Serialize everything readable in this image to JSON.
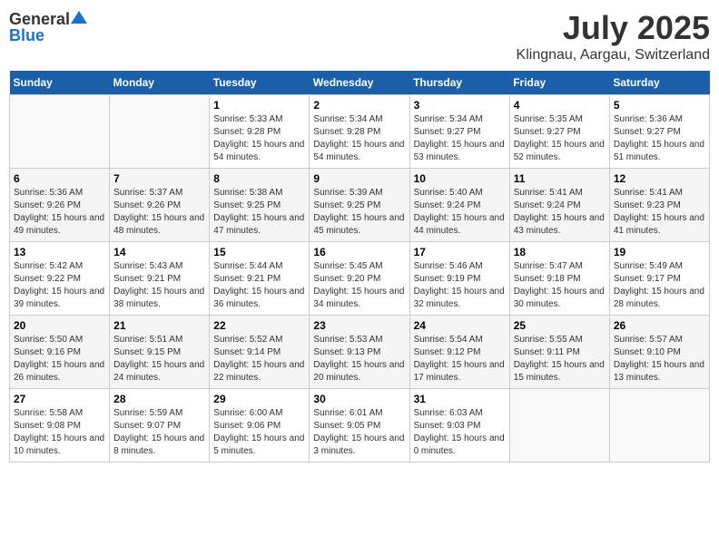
{
  "logo": {
    "general": "General",
    "blue": "Blue"
  },
  "title": "July 2025",
  "subtitle": "Klingnau, Aargau, Switzerland",
  "days_header": [
    "Sunday",
    "Monday",
    "Tuesday",
    "Wednesday",
    "Thursday",
    "Friday",
    "Saturday"
  ],
  "weeks": [
    [
      {
        "num": "",
        "sunrise": "",
        "sunset": "",
        "daylight": ""
      },
      {
        "num": "",
        "sunrise": "",
        "sunset": "",
        "daylight": ""
      },
      {
        "num": "1",
        "sunrise": "Sunrise: 5:33 AM",
        "sunset": "Sunset: 9:28 PM",
        "daylight": "Daylight: 15 hours and 54 minutes."
      },
      {
        "num": "2",
        "sunrise": "Sunrise: 5:34 AM",
        "sunset": "Sunset: 9:28 PM",
        "daylight": "Daylight: 15 hours and 54 minutes."
      },
      {
        "num": "3",
        "sunrise": "Sunrise: 5:34 AM",
        "sunset": "Sunset: 9:27 PM",
        "daylight": "Daylight: 15 hours and 53 minutes."
      },
      {
        "num": "4",
        "sunrise": "Sunrise: 5:35 AM",
        "sunset": "Sunset: 9:27 PM",
        "daylight": "Daylight: 15 hours and 52 minutes."
      },
      {
        "num": "5",
        "sunrise": "Sunrise: 5:36 AM",
        "sunset": "Sunset: 9:27 PM",
        "daylight": "Daylight: 15 hours and 51 minutes."
      }
    ],
    [
      {
        "num": "6",
        "sunrise": "Sunrise: 5:36 AM",
        "sunset": "Sunset: 9:26 PM",
        "daylight": "Daylight: 15 hours and 49 minutes."
      },
      {
        "num": "7",
        "sunrise": "Sunrise: 5:37 AM",
        "sunset": "Sunset: 9:26 PM",
        "daylight": "Daylight: 15 hours and 48 minutes."
      },
      {
        "num": "8",
        "sunrise": "Sunrise: 5:38 AM",
        "sunset": "Sunset: 9:25 PM",
        "daylight": "Daylight: 15 hours and 47 minutes."
      },
      {
        "num": "9",
        "sunrise": "Sunrise: 5:39 AM",
        "sunset": "Sunset: 9:25 PM",
        "daylight": "Daylight: 15 hours and 45 minutes."
      },
      {
        "num": "10",
        "sunrise": "Sunrise: 5:40 AM",
        "sunset": "Sunset: 9:24 PM",
        "daylight": "Daylight: 15 hours and 44 minutes."
      },
      {
        "num": "11",
        "sunrise": "Sunrise: 5:41 AM",
        "sunset": "Sunset: 9:24 PM",
        "daylight": "Daylight: 15 hours and 43 minutes."
      },
      {
        "num": "12",
        "sunrise": "Sunrise: 5:41 AM",
        "sunset": "Sunset: 9:23 PM",
        "daylight": "Daylight: 15 hours and 41 minutes."
      }
    ],
    [
      {
        "num": "13",
        "sunrise": "Sunrise: 5:42 AM",
        "sunset": "Sunset: 9:22 PM",
        "daylight": "Daylight: 15 hours and 39 minutes."
      },
      {
        "num": "14",
        "sunrise": "Sunrise: 5:43 AM",
        "sunset": "Sunset: 9:21 PM",
        "daylight": "Daylight: 15 hours and 38 minutes."
      },
      {
        "num": "15",
        "sunrise": "Sunrise: 5:44 AM",
        "sunset": "Sunset: 9:21 PM",
        "daylight": "Daylight: 15 hours and 36 minutes."
      },
      {
        "num": "16",
        "sunrise": "Sunrise: 5:45 AM",
        "sunset": "Sunset: 9:20 PM",
        "daylight": "Daylight: 15 hours and 34 minutes."
      },
      {
        "num": "17",
        "sunrise": "Sunrise: 5:46 AM",
        "sunset": "Sunset: 9:19 PM",
        "daylight": "Daylight: 15 hours and 32 minutes."
      },
      {
        "num": "18",
        "sunrise": "Sunrise: 5:47 AM",
        "sunset": "Sunset: 9:18 PM",
        "daylight": "Daylight: 15 hours and 30 minutes."
      },
      {
        "num": "19",
        "sunrise": "Sunrise: 5:49 AM",
        "sunset": "Sunset: 9:17 PM",
        "daylight": "Daylight: 15 hours and 28 minutes."
      }
    ],
    [
      {
        "num": "20",
        "sunrise": "Sunrise: 5:50 AM",
        "sunset": "Sunset: 9:16 PM",
        "daylight": "Daylight: 15 hours and 26 minutes."
      },
      {
        "num": "21",
        "sunrise": "Sunrise: 5:51 AM",
        "sunset": "Sunset: 9:15 PM",
        "daylight": "Daylight: 15 hours and 24 minutes."
      },
      {
        "num": "22",
        "sunrise": "Sunrise: 5:52 AM",
        "sunset": "Sunset: 9:14 PM",
        "daylight": "Daylight: 15 hours and 22 minutes."
      },
      {
        "num": "23",
        "sunrise": "Sunrise: 5:53 AM",
        "sunset": "Sunset: 9:13 PM",
        "daylight": "Daylight: 15 hours and 20 minutes."
      },
      {
        "num": "24",
        "sunrise": "Sunrise: 5:54 AM",
        "sunset": "Sunset: 9:12 PM",
        "daylight": "Daylight: 15 hours and 17 minutes."
      },
      {
        "num": "25",
        "sunrise": "Sunrise: 5:55 AM",
        "sunset": "Sunset: 9:11 PM",
        "daylight": "Daylight: 15 hours and 15 minutes."
      },
      {
        "num": "26",
        "sunrise": "Sunrise: 5:57 AM",
        "sunset": "Sunset: 9:10 PM",
        "daylight": "Daylight: 15 hours and 13 minutes."
      }
    ],
    [
      {
        "num": "27",
        "sunrise": "Sunrise: 5:58 AM",
        "sunset": "Sunset: 9:08 PM",
        "daylight": "Daylight: 15 hours and 10 minutes."
      },
      {
        "num": "28",
        "sunrise": "Sunrise: 5:59 AM",
        "sunset": "Sunset: 9:07 PM",
        "daylight": "Daylight: 15 hours and 8 minutes."
      },
      {
        "num": "29",
        "sunrise": "Sunrise: 6:00 AM",
        "sunset": "Sunset: 9:06 PM",
        "daylight": "Daylight: 15 hours and 5 minutes."
      },
      {
        "num": "30",
        "sunrise": "Sunrise: 6:01 AM",
        "sunset": "Sunset: 9:05 PM",
        "daylight": "Daylight: 15 hours and 3 minutes."
      },
      {
        "num": "31",
        "sunrise": "Sunrise: 6:03 AM",
        "sunset": "Sunset: 9:03 PM",
        "daylight": "Daylight: 15 hours and 0 minutes."
      },
      {
        "num": "",
        "sunrise": "",
        "sunset": "",
        "daylight": ""
      },
      {
        "num": "",
        "sunrise": "",
        "sunset": "",
        "daylight": ""
      }
    ]
  ]
}
